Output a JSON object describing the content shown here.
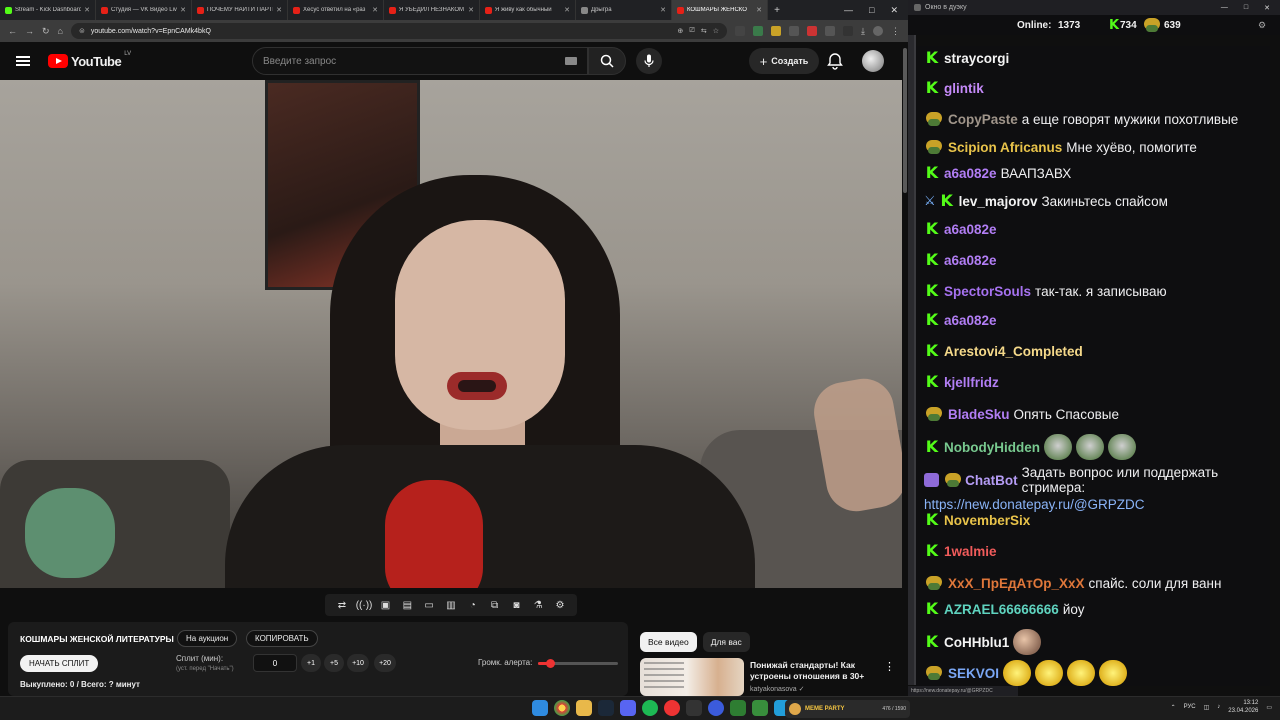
{
  "browser": {
    "tabs": [
      {
        "title": "Stream - Kick Dashboard",
        "color": "#53fc18",
        "active": false
      },
      {
        "title": "Студия — VK Видео Live",
        "color": "#e62117",
        "active": false
      },
      {
        "title": "ПОЧЕМУ НАЙТИ ПАРТН",
        "color": "#e62117",
        "active": false
      },
      {
        "title": "Хесус ответил на «раз",
        "color": "#e62117",
        "active": false
      },
      {
        "title": "Я УБЕДИЛ НЕЗНАКОМ",
        "color": "#e62117",
        "active": false
      },
      {
        "title": "Я живу как обычный",
        "color": "#e62117",
        "active": false
      },
      {
        "title": "Дрыгра",
        "color": "#888888",
        "active": false
      },
      {
        "title": "КОШМАРЫ ЖЕНСКО",
        "color": "#e62117",
        "active": true
      }
    ],
    "url": "youtube.com/watch?v=EpnCAMk4bkQ"
  },
  "youtube": {
    "logo_text": "YouTube",
    "region": "LV",
    "search_placeholder": "Введите запрос",
    "create_label": "Создать"
  },
  "ext_toolbar": {
    "icons": [
      "repeat-icon",
      "audio-icon",
      "cinema-icon",
      "frame-icon",
      "fullwindow-icon",
      "subtitles-icon",
      "speed-icon",
      "pip-icon",
      "screenshot-icon",
      "flask-icon",
      "gear-icon"
    ],
    "glyphs": [
      "⇄",
      "((·))",
      "▣",
      "▤",
      "▭",
      "▥",
      "◔",
      "⧉",
      "◙",
      "⚗",
      "⚙"
    ]
  },
  "auction": {
    "title": "КОШМАРЫ ЖЕНСКОЙ ЛИТЕРАТУРЫ",
    "to_auction": "На аукцион",
    "copy": "КОПИРОВАТЬ",
    "start_split": "НАЧАТЬ СПЛИТ",
    "split_label": "Сплит (мин):",
    "split_hint": "(уст. перед \"Начать\")",
    "split_value": "0",
    "increments": [
      "+1",
      "+5",
      "+10",
      "+20"
    ],
    "alert_volume_label": "Громк. алерта:",
    "alert_volume": 0.15,
    "bought": "Выкуплено: 0 / Всего: ? минут"
  },
  "recs": {
    "tabs": [
      "Все видео",
      "Для вас"
    ],
    "card": {
      "title": "Понижай стандарты! Как устроены отношения в 30+",
      "author": "katyakonasova"
    }
  },
  "chat": {
    "window_title": "Окно в дуэку",
    "online_label": "Online:",
    "online_count": "1373",
    "kick_count": "734",
    "vk_count": "639",
    "colors": {
      "kick": "#53fc18"
    },
    "messages": [
      {
        "badge": "kick",
        "user": "straycorgi",
        "color": "#f3f3f3",
        "text": "",
        "emotes": [
          "face",
          "face",
          "face"
        ]
      },
      {
        "badge": "kick",
        "user": "glintik",
        "color": "#c58af9",
        "text": "",
        "emotes": [
          "face"
        ]
      },
      {
        "badge": "pepe",
        "user": "CopyPaste",
        "color": "#a0958a",
        "text": "а еще говорят мужики похотливые",
        "emotes": []
      },
      {
        "badge": "pepe",
        "user": "Scipion Africanus",
        "color": "#e8c34a",
        "text": "Мне хуёво, помогите",
        "emotes": []
      },
      {
        "badge": "kick",
        "user": "a6a082e",
        "color": "#b27ef5",
        "text": "ВААПЗАВХ",
        "emotes": []
      },
      {
        "badge": "sword",
        "user": "lev_majorov",
        "color": "#f3f3f3",
        "text": "Закиньтесь спайсом",
        "emotes": []
      },
      {
        "badge": "kick",
        "user": "a6a082e",
        "color": "#b27ef5",
        "text": "",
        "emotes": [
          "face"
        ]
      },
      {
        "badge": "kick",
        "user": "a6a082e",
        "color": "#b27ef5",
        "text": "",
        "emotes": [
          "face"
        ]
      },
      {
        "badge": "kick",
        "user": "SpectorSouls",
        "color": "#a672f0",
        "text": "так-так. я записываю",
        "emotes": []
      },
      {
        "badge": "kick",
        "user": "a6a082e",
        "color": "#b27ef5",
        "text": "",
        "emotes": [
          "face"
        ]
      },
      {
        "badge": "kick",
        "user": "Arestovi4_Completed",
        "color": "#f5d98a",
        "text": "",
        "emotes": [
          "face"
        ]
      },
      {
        "badge": "kick",
        "user": "kjellfridz",
        "color": "#b27ef5",
        "text": "",
        "emotes": [
          "face"
        ]
      },
      {
        "badge": "pepe",
        "user": "BladeSku",
        "color": "#b27ef5",
        "text": "Опять Спасовые",
        "emotes": []
      },
      {
        "badge": "kick",
        "user": "NobodyHidden",
        "color": "#78c98f",
        "text": "",
        "emotes": [
          "pepe",
          "pepe",
          "pepe"
        ]
      },
      {
        "badge": "kick",
        "user": "NovemberSix",
        "color": "#e8c34a",
        "text": "",
        "emotes": [
          "face"
        ]
      },
      {
        "badge": "kick",
        "user": "1walmie",
        "color": "#f05b5b",
        "text": "",
        "emotes": [
          "face"
        ]
      },
      {
        "badge": "pepe",
        "user": "XxX_ПрЕдАтОр_XxX",
        "color": "#e0773a",
        "text": "спайс. соли для ванн",
        "emotes": []
      },
      {
        "badge": "kick",
        "user": "AZRAEL66666666",
        "color": "#5fd3bf",
        "text": "йоу",
        "emotes": []
      },
      {
        "badge": "kick",
        "user": "CoHHblu1",
        "color": "#f3f3f3",
        "text": "",
        "emotes": [
          "bald"
        ]
      },
      {
        "badge": "pepe",
        "user": "SEKVOI",
        "color": "#7aa7f5",
        "text": "",
        "emotes": [
          "laugh",
          "laugh",
          "laugh",
          "laugh"
        ]
      }
    ],
    "chatbot": {
      "user": "ChatBot",
      "color": "#b59cf5",
      "text": "Задать вопрос или поддержать стримера:",
      "link": "https://new.donatepay.ru/@GRPZDC"
    },
    "status_url": "https://new.donatepay.ru/@GRPZDC"
  },
  "taskbar": {
    "game_label": "MEME PARTY",
    "game_counter": "476 / 1590",
    "lang": "РУС",
    "time": "13:12",
    "date": "23.04.2026"
  }
}
